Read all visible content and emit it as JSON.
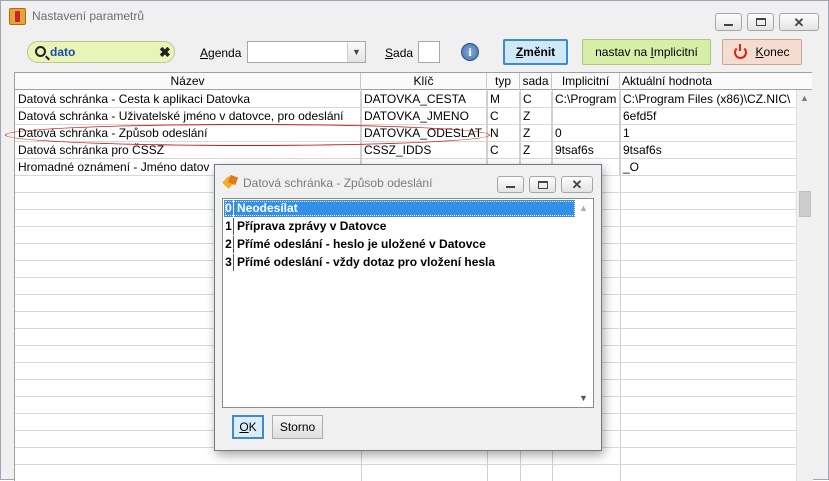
{
  "window": {
    "title": "Nastavení parametrů"
  },
  "toolbar": {
    "search_value": "dato",
    "agenda_label_underlined": "A",
    "agenda_label_rest": "genda",
    "sada_label_underlined": "S",
    "sada_label_rest": "ada",
    "agenda_value": "",
    "sada_value": "",
    "zmenit_underlined": "Z",
    "zmenit_rest": "měnit",
    "nastav_label_start": "nastav na ",
    "nastav_underlined": "I",
    "nastav_rest": "mplicitní",
    "konec_underlined": "K",
    "konec_rest": "onec"
  },
  "grid": {
    "columns": [
      "Název",
      "Klíč",
      "typ",
      "sada",
      "Implicitní",
      "Aktuální hodnota"
    ],
    "rows": [
      {
        "nazev": "Datová schránka - Cesta k aplikaci Datovka",
        "klic": "DATOVKA_CESTA",
        "typ": "M",
        "sada": "C",
        "implicitni": "C:\\Program",
        "aktualni": "C:\\Program Files (x86)\\CZ.NIC\\"
      },
      {
        "nazev": "Datová schránka - Uživatelské jméno v datovce, pro odeslání",
        "klic": "DATOVKA_JMENO",
        "typ": "C",
        "sada": "Z",
        "implicitni": "",
        "aktualni": "6efd5f"
      },
      {
        "nazev": "Datová schránka - Způsob odeslání",
        "klic": "DATOVKA_ODESLAT",
        "typ": "N",
        "sada": "Z",
        "implicitni": "0",
        "aktualni": "1"
      },
      {
        "nazev": "Datová schránka pro ČSSZ",
        "klic": "CSSZ_IDDS",
        "typ": "C",
        "sada": "Z",
        "implicitni": "9tsaf6s",
        "aktualni": "9tsaf6s"
      },
      {
        "nazev": "Hromadné oznámení -  Jméno datov",
        "klic": "",
        "typ": "",
        "sada": "",
        "implicitni": "",
        "aktualni": "_O"
      }
    ]
  },
  "dialog": {
    "title": "Datová schránka - Způsob odeslání",
    "options": [
      {
        "num": "0",
        "label": "Neodesílat"
      },
      {
        "num": "1",
        "label": "Příprava zprávy v Datovce"
      },
      {
        "num": "2",
        "label": "Přímé odeslání - heslo je uložené v Datovce"
      },
      {
        "num": "3",
        "label": "Přímé odeslání - vždy dotaz pro vložení hesla"
      }
    ],
    "selected_index": 0,
    "ok_underlined": "O",
    "ok_rest": "K",
    "storno_label": "Storno"
  },
  "colors": {
    "search_bg": "#e9f5b6",
    "selection": "#3390e8",
    "highlight_ellipse": "#d21818",
    "zmenit_bg": "#cfe9f7",
    "nastav_bg": "#d7eea9",
    "konec_bg": "#f4ddd0"
  },
  "icons": {
    "app": "app-logo-icon",
    "search": "search-icon",
    "clear": "clear-icon",
    "info": "info-icon",
    "konec": "power-icon",
    "dialog": "dialog-logo-icon"
  }
}
